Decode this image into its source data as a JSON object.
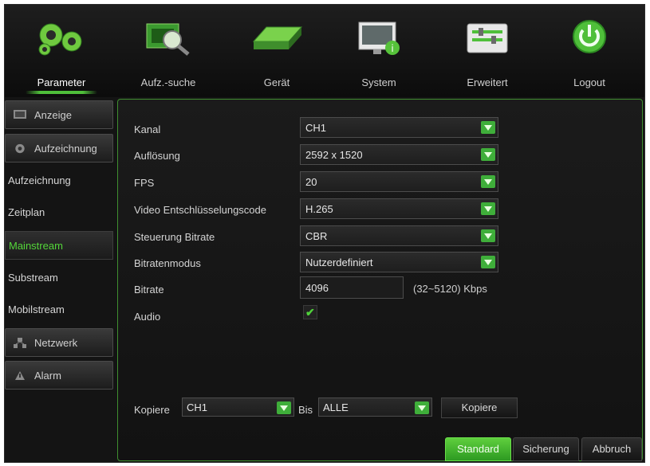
{
  "nav": {
    "tabs": [
      {
        "label": "Parameter",
        "icon": "gears-icon",
        "active": true
      },
      {
        "label": "Aufz.-suche",
        "icon": "record-search-icon",
        "active": false
      },
      {
        "label": "Gerät",
        "icon": "hard-disk-icon",
        "active": false
      },
      {
        "label": "System",
        "icon": "system-info-icon",
        "active": false
      },
      {
        "label": "Erweitert",
        "icon": "advanced-settings-icon",
        "active": false
      },
      {
        "label": "Logout",
        "icon": "power-icon",
        "active": false
      }
    ]
  },
  "sidebar": {
    "items": [
      {
        "label": "Anzeige",
        "type": "category",
        "icon": "display-icon"
      },
      {
        "label": "Aufzeichnung",
        "type": "category",
        "icon": "record-settings-icon"
      },
      {
        "label": "Aufzeichnung",
        "type": "sub"
      },
      {
        "label": "Zeitplan",
        "type": "sub"
      },
      {
        "label": "Mainstream",
        "type": "sub",
        "active": true
      },
      {
        "label": "Substream",
        "type": "sub"
      },
      {
        "label": "Mobilstream",
        "type": "sub"
      },
      {
        "label": "Netzwerk",
        "type": "category",
        "icon": "network-icon"
      },
      {
        "label": "Alarm",
        "type": "category",
        "icon": "alarm-icon"
      }
    ]
  },
  "form": {
    "kanal": {
      "label": "Kanal",
      "value": "CH1"
    },
    "aufloesung": {
      "label": "Auflösung",
      "value": "2592 x 1520"
    },
    "fps": {
      "label": "FPS",
      "value": "20"
    },
    "codec": {
      "label": "Video Entschlüsselungscode",
      "value": "H.265"
    },
    "steuerung": {
      "label": "Steuerung Bitrate",
      "value": "CBR"
    },
    "modus": {
      "label": "Bitratenmodus",
      "value": "Nutzerdefiniert"
    },
    "bitrate": {
      "label": "Bitrate",
      "value": "4096",
      "range": "(32~5120) Kbps"
    },
    "audio": {
      "label": "Audio",
      "checked": true
    }
  },
  "copy": {
    "label": "Kopiere",
    "from": "CH1",
    "bis_label": "Bis",
    "to": "ALLE",
    "button": "Kopiere"
  },
  "footer": {
    "standard": "Standard",
    "sicherung": "Sicherung",
    "abbruch": "Abbruch"
  },
  "colors": {
    "accent": "#3fae3a",
    "active_text": "#54d63a"
  }
}
